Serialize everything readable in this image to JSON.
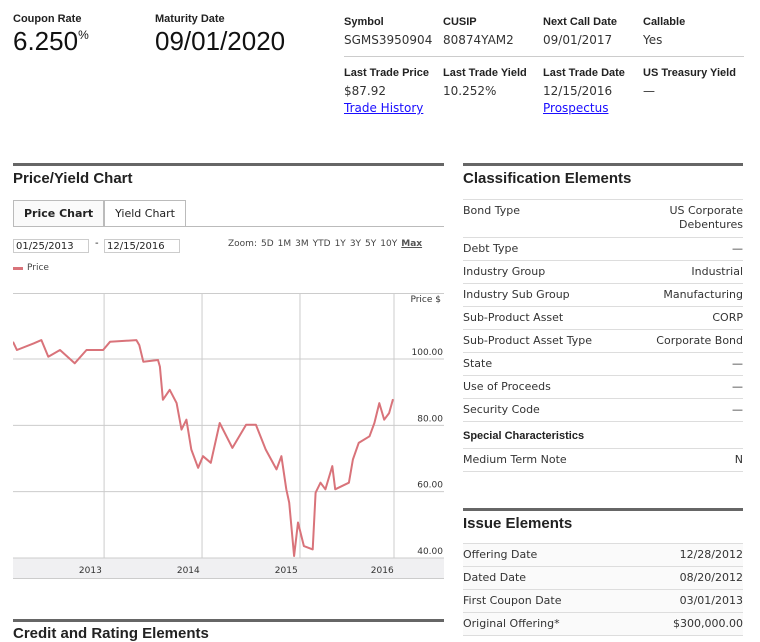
{
  "header": {
    "coupon_rate": {
      "label": "Coupon Rate",
      "value": "6.250",
      "unit": "%"
    },
    "maturity_date": {
      "label": "Maturity Date",
      "value": "09/01/2020"
    },
    "fields_top": [
      {
        "label": "Symbol",
        "value": "SGMS3950904"
      },
      {
        "label": "CUSIP",
        "value": "80874YAM2"
      },
      {
        "label": "Next Call Date",
        "value": "09/01/2017"
      },
      {
        "label": "Callable",
        "value": "Yes"
      }
    ],
    "fields_bottom": [
      {
        "label": "Last Trade Price",
        "value": "$87.92",
        "link": "Trade History"
      },
      {
        "label": "Last Trade Yield",
        "value": "10.252%"
      },
      {
        "label": "Last Trade Date",
        "value": "12/15/2016",
        "link": "Prospectus"
      },
      {
        "label": "US Treasury Yield",
        "value": "—"
      }
    ]
  },
  "chart_section": {
    "title": "Price/Yield Chart",
    "tabs": [
      "Price Chart",
      "Yield Chart"
    ],
    "start_date": "01/25/2013",
    "end_date": "12/15/2016",
    "date_sep": "-",
    "zoom_label": "Zoom:",
    "zoom_options": [
      "5D",
      "1M",
      "3M",
      "YTD",
      "1Y",
      "3Y",
      "5Y",
      "10Y",
      "Max"
    ],
    "legend": "Price"
  },
  "chart_data": {
    "type": "line",
    "title": "",
    "ylabel": "Price $",
    "xlabel": "",
    "color": "#d9737a",
    "xlim": [
      2013.07,
      2016.96
    ],
    "ylim": [
      40,
      105
    ],
    "yticks": [
      "100.00",
      "80.00",
      "60.00",
      "40.00"
    ],
    "ytick_values": [
      100,
      80,
      60,
      40
    ],
    "xgrid": [
      2014.0,
      2015.0,
      2016.0,
      2016.96
    ],
    "xticks": [
      {
        "label": "2013",
        "at": 2013.86
      },
      {
        "label": "2014",
        "at": 2014.86
      },
      {
        "label": "2015",
        "at": 2015.86
      },
      {
        "label": "2016",
        "at": 2016.84
      }
    ],
    "series": [
      {
        "name": "Price",
        "x": [
          2013.07,
          2013.11,
          2013.28,
          2013.36,
          2013.43,
          2013.55,
          2013.7,
          2013.82,
          2013.99,
          2014.06,
          2014.33,
          2014.36,
          2014.4,
          2014.55,
          2014.57,
          2014.6,
          2014.67,
          2014.74,
          2014.79,
          2014.84,
          2014.89,
          2014.96,
          2015.01,
          2015.09,
          2015.18,
          2015.31,
          2015.45,
          2015.55,
          2015.65,
          2015.76,
          2015.81,
          2015.86,
          2015.89,
          2015.94,
          2015.98,
          2016.04,
          2016.13,
          2016.16,
          2016.21,
          2016.26,
          2016.33,
          2016.36,
          2016.5,
          2016.54,
          2016.6,
          2016.71,
          2016.76,
          2016.81,
          2016.86,
          2016.91,
          2016.95
        ],
        "y": [
          105.2,
          102.7,
          104.7,
          105.7,
          100.7,
          102.7,
          98.7,
          102.7,
          102.7,
          105.2,
          105.7,
          104.2,
          99.2,
          99.7,
          97.7,
          87.7,
          90.7,
          86.7,
          78.7,
          81.7,
          72.7,
          67.2,
          70.7,
          68.7,
          80.7,
          73.2,
          80.2,
          80.2,
          72.7,
          66.7,
          70.7,
          60.7,
          56.7,
          40.6,
          50.7,
          43.6,
          42.6,
          59.7,
          62.7,
          60.7,
          67.7,
          60.7,
          62.7,
          69.7,
          74.7,
          76.7,
          80.7,
          86.7,
          81.7,
          83.7,
          87.9
        ]
      }
    ]
  },
  "classification": {
    "title": "Classification Elements",
    "rows": [
      {
        "label": "Bond Type",
        "value": "US Corporate Debentures"
      },
      {
        "label": "Debt Type",
        "value": "—"
      },
      {
        "label": "Industry Group",
        "value": "Industrial"
      },
      {
        "label": "Industry Sub Group",
        "value": "Manufacturing"
      },
      {
        "label": "Sub-Product Asset",
        "value": "CORP"
      },
      {
        "label": "Sub-Product Asset Type",
        "value": "Corporate Bond"
      },
      {
        "label": "State",
        "value": "—"
      },
      {
        "label": "Use of Proceeds",
        "value": "—"
      },
      {
        "label": "Security Code",
        "value": "—"
      }
    ],
    "special_title": "Special Characteristics",
    "special_rows": [
      {
        "label": "Medium Term Note",
        "value": "N"
      }
    ]
  },
  "issue": {
    "title": "Issue Elements",
    "rows": [
      {
        "label": "Offering Date",
        "value": "12/28/2012"
      },
      {
        "label": "Dated Date",
        "value": "08/20/2012"
      },
      {
        "label": "First Coupon Date",
        "value": "03/01/2013"
      },
      {
        "label": "Original Offering*",
        "value": "$300,000.00"
      }
    ]
  },
  "credit": {
    "title": "Credit and Rating Elements"
  }
}
